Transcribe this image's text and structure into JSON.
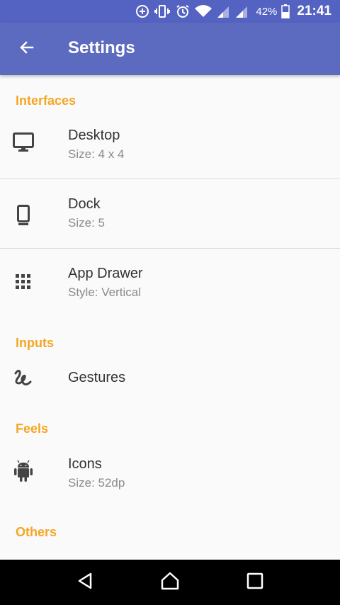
{
  "status_bar": {
    "battery_percent": "42%",
    "time": "21:41",
    "icons": [
      "data-saver-icon",
      "vibrate-icon",
      "alarm-icon",
      "wifi-icon",
      "signal-icon",
      "signal-icon",
      "battery-icon"
    ]
  },
  "app_bar": {
    "title": "Settings",
    "back_icon": "arrow-back-icon"
  },
  "sections": {
    "interfaces": "Interfaces",
    "inputs": "Inputs",
    "feels": "Feels",
    "others": "Others"
  },
  "items": {
    "desktop": {
      "title": "Desktop",
      "subtitle": "Size: 4 x 4",
      "icon": "monitor-icon"
    },
    "dock": {
      "title": "Dock",
      "subtitle": "Size: 5",
      "icon": "phone-dock-icon"
    },
    "app_drawer": {
      "title": "App Drawer",
      "subtitle": "Style: Vertical",
      "icon": "grid-icon"
    },
    "gestures": {
      "title": "Gestures",
      "icon": "gesture-icon"
    },
    "icons": {
      "title": "Icons",
      "subtitle": "Size: 52dp",
      "icon": "android-icon"
    }
  },
  "nav_bar": {
    "buttons": [
      "back-triangle-icon",
      "home-icon",
      "recents-icon"
    ]
  },
  "colors": {
    "app_bar": "#5c6bc0",
    "status_bar": "#5463c2",
    "section_header": "#f5a623",
    "background": "#fafafa"
  }
}
